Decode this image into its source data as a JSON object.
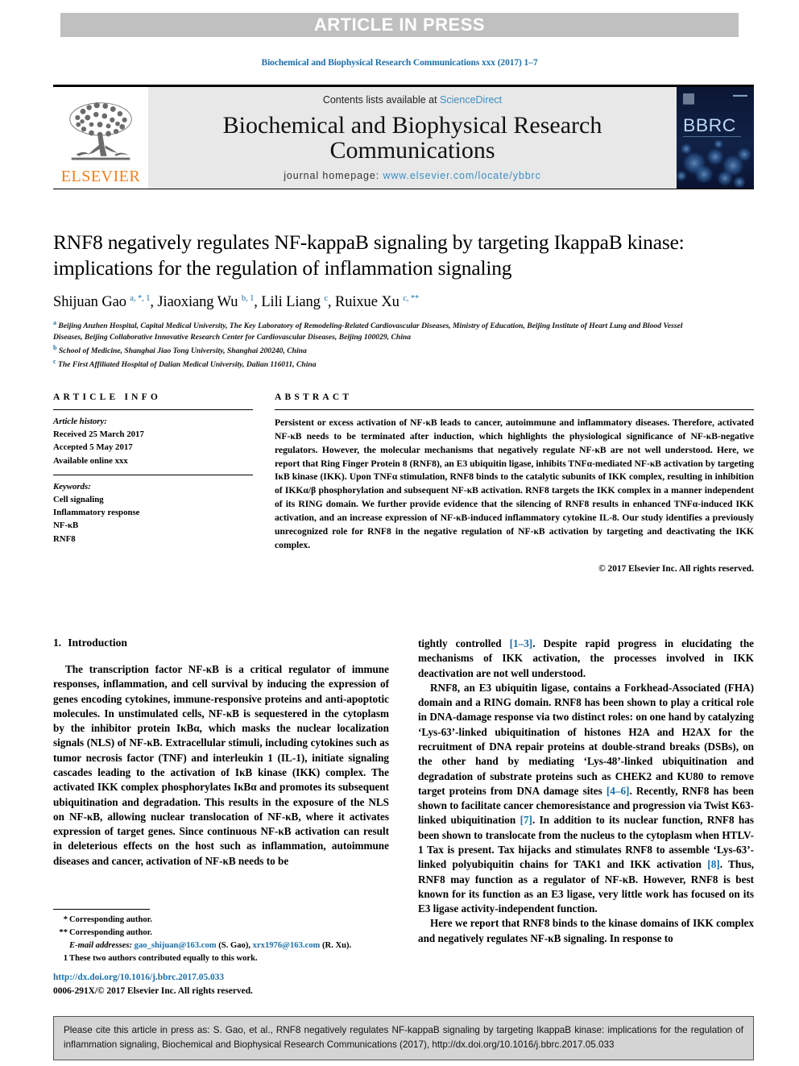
{
  "banner": {
    "text": "ARTICLE IN PRESS"
  },
  "running_head": "Biochemical and Biophysical Research Communications xxx (2017) 1–7",
  "masthead": {
    "contents_prefix": "Contents lists available at ",
    "sciencedirect": "ScienceDirect",
    "journal_title": "Biochemical and Biophysical Research Communications",
    "homepage_label": "journal homepage: ",
    "homepage_url": "www.elsevier.com/locate/ybbrc",
    "publisher_wordmark": "ELSEVIER",
    "cover_wordmark": "BBRC",
    "accent_blue": "#3a8fc4",
    "elsevier_orange": "#ec8022",
    "banner_gray": "#c0c0c0"
  },
  "article": {
    "title": "RNF8 negatively regulates NF-kappaB signaling by targeting IkappaB kinase: implications for the regulation of inflammation signaling",
    "authors_html": "Shijuan Gao <sup>a, *, 1</sup>, Jiaoxiang Wu <sup>b, 1</sup>, Lili Liang <sup>c</sup>, Ruixue Xu <sup>c, **</sup>",
    "affiliations": [
      {
        "mark": "a",
        "text": "Beijing Anzhen Hospital, Capital Medical University, The Key Laboratory of Remodeling-Related Cardiovascular Diseases, Ministry of Education, Beijing Institute of Heart Lung and Blood Vessel Diseases, Beijing Collaborative Innovative Research Center for Cardiovascular Diseases, Beijing 100029, China"
      },
      {
        "mark": "b",
        "text": "School of Medicine, Shanghai Jiao Tong University, Shanghai 200240, China"
      },
      {
        "mark": "c",
        "text": "The First Affiliated Hospital of Dalian Medical University, Dalian 116011, China"
      }
    ]
  },
  "article_info": {
    "heading": "ARTICLE INFO",
    "history_label": "Article history:",
    "history": [
      "Received 25 March 2017",
      "Accepted 5 May 2017",
      "Available online xxx"
    ],
    "keywords_label": "Keywords:",
    "keywords": [
      "Cell signaling",
      "Inflammatory response",
      "NF-κB",
      "RNF8"
    ]
  },
  "abstract": {
    "heading": "ABSTRACT",
    "text": "Persistent or excess activation of NF-κB leads to cancer, autoimmune and inflammatory diseases. Therefore, activated NF-κB needs to be terminated after induction, which highlights the physiological significance of NF-κB-negative regulators. However, the molecular mechanisms that negatively regulate NF-κB are not well understood. Here, we report that Ring Finger Protein 8 (RNF8), an E3 ubiquitin ligase, inhibits TNFα-mediated NF-κB activation by targeting IκB kinase (IKK). Upon TNFα stimulation, RNF8 binds to the catalytic subunits of IKK complex, resulting in inhibition of IKKα/β phosphorylation and subsequent NF-κB activation. RNF8 targets the IKK complex in a manner independent of its RING domain. We further provide evidence that the silencing of RNF8 results in enhanced TNFα-induced IKK activation, and an increase expression of NF-κB-induced inflammatory cytokine IL-8. Our study identifies a previously unrecognized role for RNF8 in the negative regulation of NF-κB activation by targeting and deactivating the IKK complex.",
    "copyright": "© 2017 Elsevier Inc. All rights reserved."
  },
  "introduction": {
    "number": "1.",
    "heading": "Introduction",
    "left_paragraph": "The transcription factor NF-κB is a critical regulator of immune responses, inflammation, and cell survival by inducing the expression of genes encoding cytokines, immune-responsive proteins and anti-apoptotic molecules. In unstimulated cells, NF-κB is sequestered in the cytoplasm by the inhibitor protein IκBα, which masks the nuclear localization signals (NLS) of NF-κB. Extracellular stimuli, including cytokines such as tumor necrosis factor (TNF) and interleukin 1 (IL-1), initiate signaling cascades leading to the activation of IκB kinase (IKK) complex. The activated IKK complex phosphorylates IκBα and promotes its subsequent ubiquitination and degradation. This results in the exposure of the NLS on NF-κB, allowing nuclear translocation of NF-κB, where it activates expression of target genes. Since continuous NF-κB activation can result in deleterious effects on the host such as inflammation, autoimmune diseases and cancer, activation of NF-κB needs to be",
    "right_paragraph_1_a": "tightly controlled ",
    "right_paragraph_1_ref": "[1–3]",
    "right_paragraph_1_b": ". Despite rapid progress in elucidating the mechanisms of IKK activation, the processes involved in IKK deactivation are not well understood.",
    "right_paragraph_2_a": "RNF8, an E3 ubiquitin ligase, contains a Forkhead-Associated (FHA) domain and a RING domain. RNF8 has been shown to play a critical role in DNA-damage response via two distinct roles: on one hand by catalyzing ‘Lys-63’-linked ubiquitination of histones H2A and H2AX for the recruitment of DNA repair proteins at double-strand breaks (DSBs), on the other hand by mediating ‘Lys-48’-linked ubiquitination and degradation of substrate proteins such as CHEK2 and KU80 to remove target proteins from DNA damage sites ",
    "right_paragraph_2_ref1": "[4–6]",
    "right_paragraph_2_b": ". Recently, RNF8 has been shown to facilitate cancer chemoresistance and progression via Twist K63-linked ubiquitination ",
    "right_paragraph_2_ref2": "[7]",
    "right_paragraph_2_c": ". In addition to its nuclear function, RNF8 has been shown to translocate from the nucleus to the cytoplasm when HTLV-1 Tax is present. Tax hijacks and stimulates RNF8 to assemble ‘Lys-63’-linked polyubiquitin chains for TAK1 and IKK activation ",
    "right_paragraph_2_ref3": "[8]",
    "right_paragraph_2_d": ". Thus, RNF8 may function as a regulator of NF-κB. However, RNF8 is best known for its function as an E3 ligase, very little work has focused on its E3 ligase activity-independent function.",
    "right_paragraph_3": "Here we report that RNF8 binds to the kinase domains of IKK complex and negatively regulates NF-κB signaling. In response to"
  },
  "footnotes": {
    "corr1_mark": "*",
    "corr1_text": "Corresponding author.",
    "corr2_mark": "**",
    "corr2_text": "Corresponding author.",
    "email_label": "E-mail addresses:",
    "email1": "gao_shijuan@163.com",
    "email1_who": "(S. Gao)",
    "email2": "xrx1976@163.com",
    "email2_who": "(R. Xu).",
    "note1_mark": "1",
    "note1_text": "These two authors contributed equally to this work."
  },
  "doi_block": {
    "doi_url": "http://dx.doi.org/10.1016/j.bbrc.2017.05.033",
    "issn_line": "0006-291X/© 2017 Elsevier Inc. All rights reserved."
  },
  "citation_box": {
    "text": "Please cite this article in press as: S. Gao, et al., RNF8 negatively regulates NF-kappaB signaling by targeting IkappaB kinase: implications for the regulation of inflammation signaling, Biochemical and Biophysical Research Communications (2017), http://dx.doi.org/10.1016/j.bbrc.2017.05.033"
  }
}
